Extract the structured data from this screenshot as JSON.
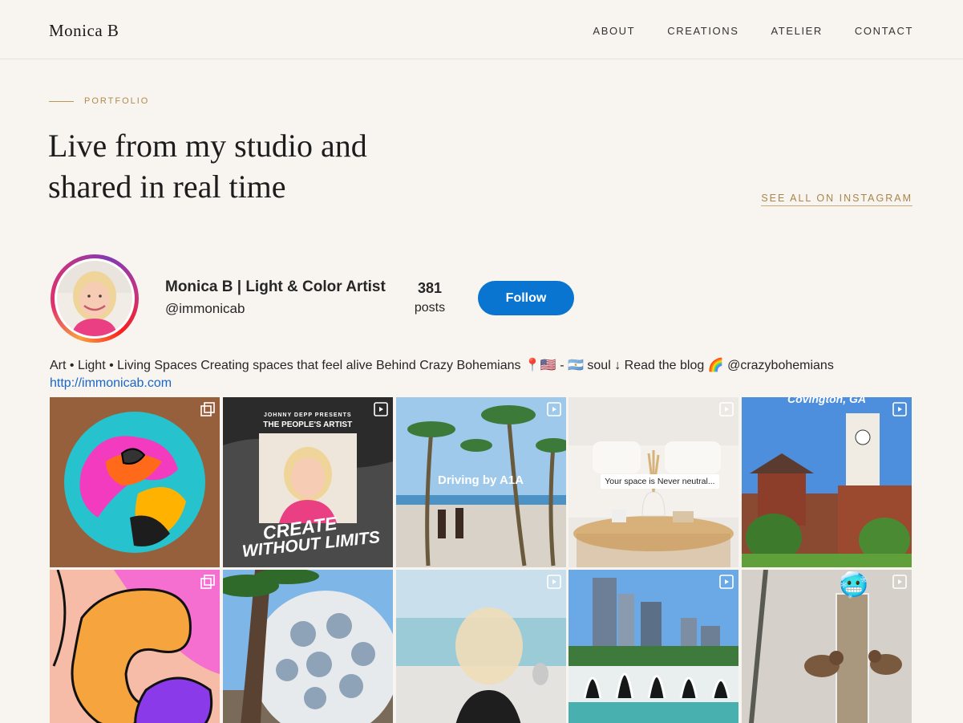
{
  "header": {
    "brand": "Monica B",
    "nav": [
      "ABOUT",
      "CREATIONS",
      "ATELIER",
      "CONTACT"
    ]
  },
  "portfolio": {
    "eyebrow": "PORTFOLIO",
    "headline_line1": "Live from my studio and",
    "headline_line2": "shared in real time",
    "see_all": "SEE ALL ON INSTAGRAM"
  },
  "profile": {
    "name": "Monica B | Light & Color Artist",
    "handle": "@immonicab",
    "posts_count": "381",
    "posts_label": "posts",
    "follow_label": "Follow",
    "bio": "Art • Light • Living Spaces Creating spaces that feel alive Behind Crazy Bohemians 📍🇺🇸 - 🇦🇷 soul ↓ Read the blog 🌈 @crazybohemians",
    "link": "http://immonicab.com"
  },
  "tiles": [
    {
      "name": "post-abstract-circle",
      "badge": "carousel"
    },
    {
      "name": "post-create-without-limits",
      "badge": "reel",
      "text_top": "JOHNNY DEPP PRESENTS",
      "text_sub": "THE PEOPLE'S ARTIST",
      "text_big1": "CREATE",
      "text_big2": "WITHOUT LIMITS"
    },
    {
      "name": "post-driving-a1a",
      "badge": "reel",
      "overlay": "Driving by A1A"
    },
    {
      "name": "post-living-room",
      "badge": "reel",
      "caption": "Your space is Never neutral..."
    },
    {
      "name": "post-covington-clocktower",
      "badge": "reel",
      "overlay": "Covington, GA"
    },
    {
      "name": "post-orange-blob",
      "badge": "carousel"
    },
    {
      "name": "post-geodesic-sphere",
      "badge": "none"
    },
    {
      "name": "post-beach-selfie",
      "badge": "reel"
    },
    {
      "name": "post-fountain-skyline",
      "badge": "reel"
    },
    {
      "name": "post-bird-feeder",
      "badge": "reel",
      "emoji": "🥶"
    }
  ],
  "colors": {
    "background": "#f8f5f0",
    "accent_gold": "#b08a4e",
    "follow_blue": "#0a74d1",
    "link_blue": "#1a66c8"
  }
}
